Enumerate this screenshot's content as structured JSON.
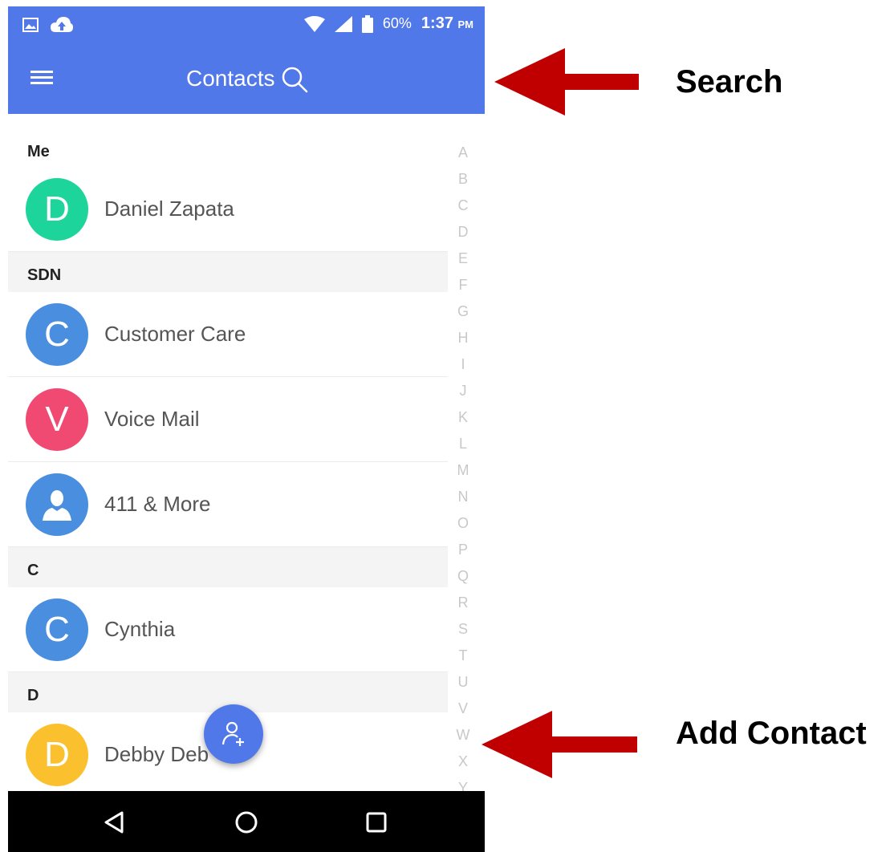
{
  "status_bar": {
    "battery_text": "60%",
    "time": "1:37",
    "time_suffix": "PM"
  },
  "app_bar": {
    "title": "Contacts",
    "menu_icon": "hamburger-menu-icon",
    "search_icon": "search-icon",
    "color": "#5178e8"
  },
  "sections": [
    {
      "header": "Me",
      "contacts": [
        {
          "initial": "D",
          "name": "Daniel Zapata",
          "color": "#1dd49a"
        }
      ]
    },
    {
      "header": "SDN",
      "contacts": [
        {
          "initial": "C",
          "name": "Customer Care",
          "color": "#4a8ee0"
        },
        {
          "initial": "V",
          "name": "Voice Mail",
          "color": "#f04a73"
        },
        {
          "initial": "",
          "name": "411 & More",
          "color": "#4a8ee0",
          "icon": "person-silhouette-icon"
        }
      ]
    },
    {
      "header": "C",
      "contacts": [
        {
          "initial": "C",
          "name": "Cynthia",
          "color": "#4a8ee0"
        }
      ]
    },
    {
      "header": "D",
      "contacts": [
        {
          "initial": "D",
          "name": "Debby Deb",
          "color": "#fbc02d"
        }
      ]
    }
  ],
  "alphabet_index": [
    "A",
    "B",
    "C",
    "D",
    "E",
    "F",
    "G",
    "H",
    "I",
    "J",
    "K",
    "L",
    "M",
    "N",
    "O",
    "P",
    "Q",
    "R",
    "S",
    "T",
    "U",
    "V",
    "W",
    "X",
    "Y"
  ],
  "fab": {
    "icon": "add-contact-icon"
  },
  "nav_bar": {
    "back_icon": "back-triangle-icon",
    "home_icon": "home-circle-icon",
    "recent_icon": "recents-square-icon"
  },
  "annotations": {
    "search_label": "Search",
    "add_contact_label": "Add Contact",
    "arrow_color": "#c00000"
  }
}
